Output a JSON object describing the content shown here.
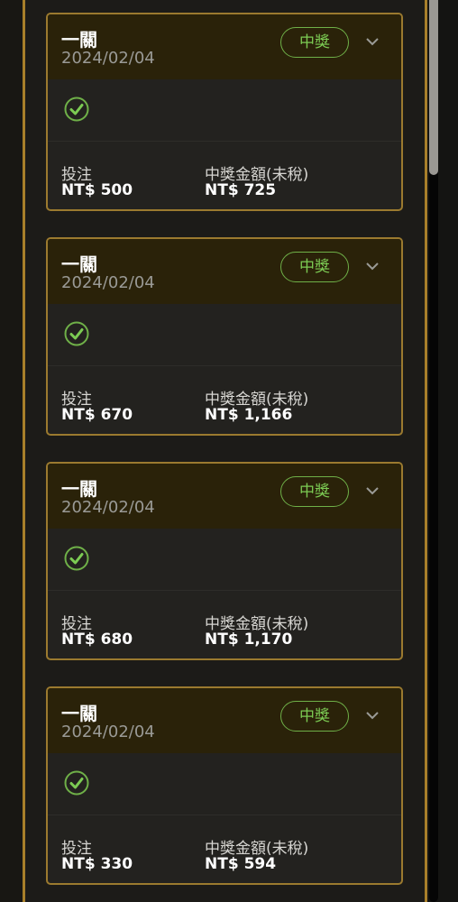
{
  "colors": {
    "accent_gold": "#9b7a2f",
    "header_bg": "#2a2209",
    "card_bg": "#23221f",
    "win_green": "#7ccb53",
    "text_white": "#ffffff",
    "text_muted": "#9a9a96"
  },
  "bets": [
    {
      "title": "一關",
      "date": "2024/02/04",
      "status": "中獎",
      "stake_label": "投注",
      "stake_value": "NT$ 500",
      "payout_label": "中獎金額(未稅)",
      "payout_value": "NT$ 725",
      "result_icon": "check-circle-icon",
      "expand_icon": "chevron-down-icon"
    },
    {
      "title": "一關",
      "date": "2024/02/04",
      "status": "中獎",
      "stake_label": "投注",
      "stake_value": "NT$ 670",
      "payout_label": "中獎金額(未稅)",
      "payout_value": "NT$ 1,166",
      "result_icon": "check-circle-icon",
      "expand_icon": "chevron-down-icon"
    },
    {
      "title": "一關",
      "date": "2024/02/04",
      "status": "中獎",
      "stake_label": "投注",
      "stake_value": "NT$ 680",
      "payout_label": "中獎金額(未稅)",
      "payout_value": "NT$ 1,170",
      "result_icon": "check-circle-icon",
      "expand_icon": "chevron-down-icon"
    },
    {
      "title": "一關",
      "date": "2024/02/04",
      "status": "中獎",
      "stake_label": "投注",
      "stake_value": "NT$ 330",
      "payout_label": "中獎金額(未稅)",
      "payout_value": "NT$ 594",
      "result_icon": "check-circle-icon",
      "expand_icon": "chevron-down-icon"
    }
  ]
}
